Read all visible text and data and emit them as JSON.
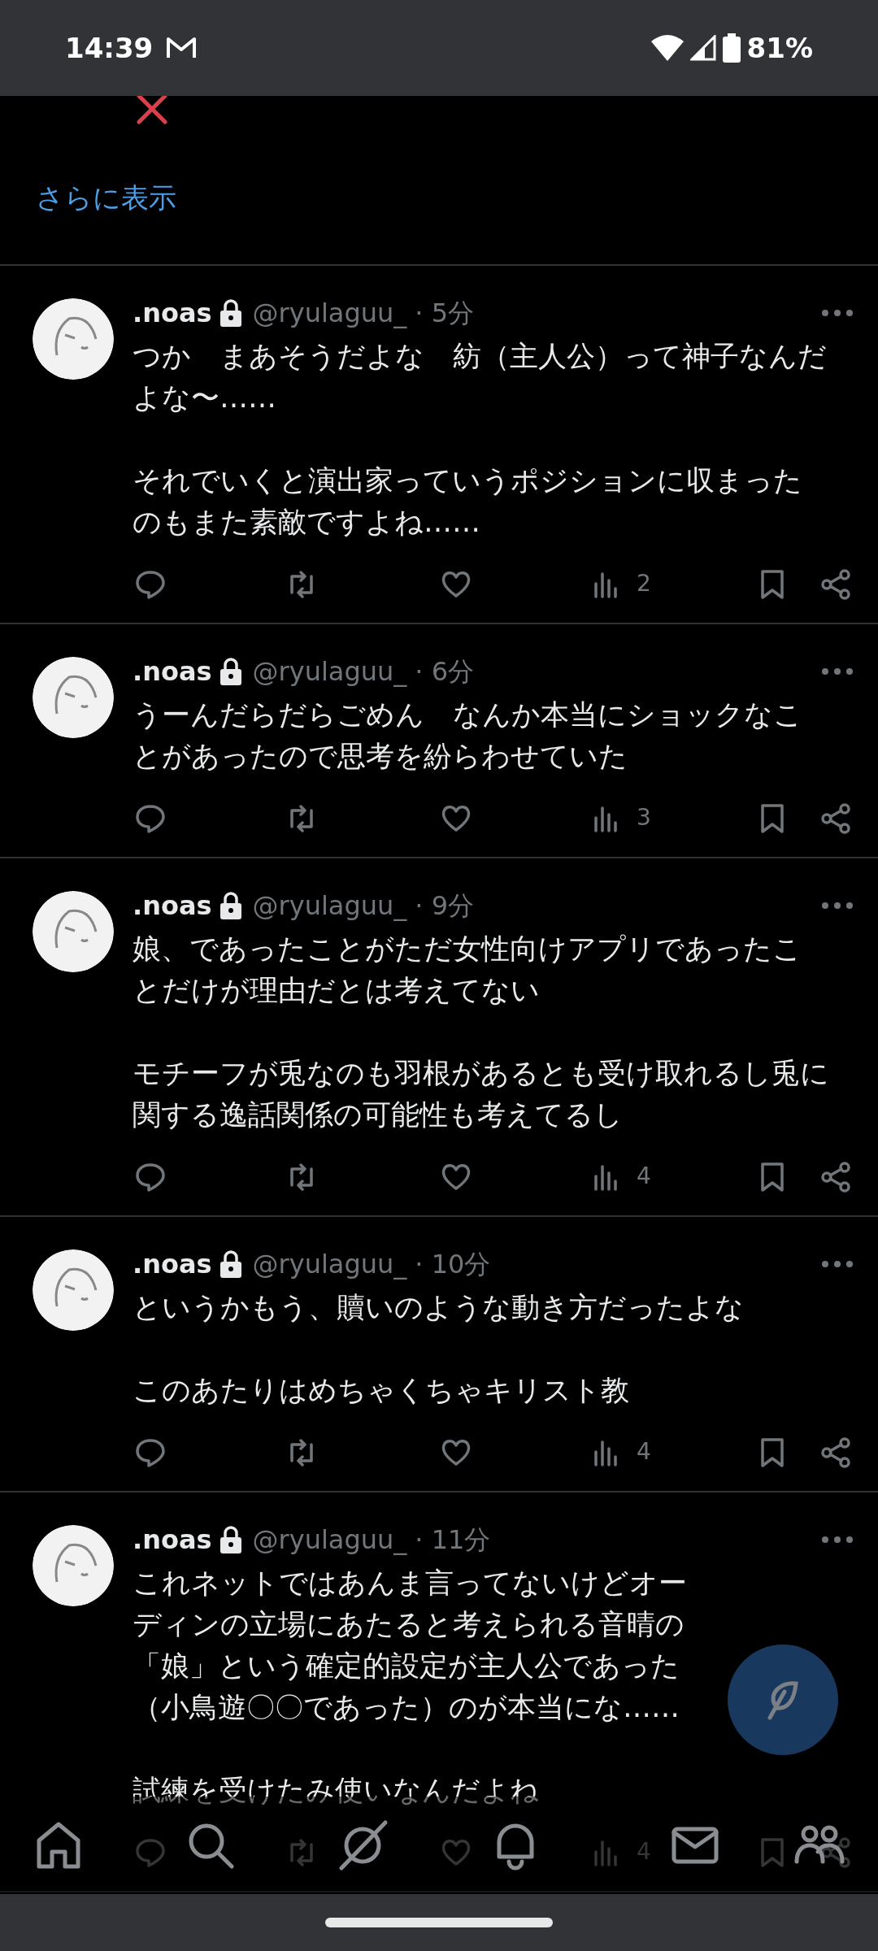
{
  "status_bar": {
    "time": "14:39",
    "battery": "81%"
  },
  "previous_post": {
    "show_more": "さらに表示"
  },
  "posts": [
    {
      "name": ".noas",
      "handle": "@ryulaguu_",
      "time": "· 5分",
      "paragraphs": [
        "つか　まあそうだよな　紡（主人公）って神子なんだよな〜……",
        "それでいくと演出家っていうポジションに収まったのもまた素敵ですよね……"
      ],
      "views": "2"
    },
    {
      "name": ".noas",
      "handle": "@ryulaguu_",
      "time": "· 6分",
      "paragraphs": [
        "うーんだらだらごめん　なんか本当にショックなことがあったので思考を紛らわせていた"
      ],
      "views": "3"
    },
    {
      "name": ".noas",
      "handle": "@ryulaguu_",
      "time": "· 9分",
      "paragraphs": [
        "娘、であったことがただ女性向けアプリであったことだけが理由だとは考えてない",
        "モチーフが兎なのも羽根があるとも受け取れるし兎に関する逸話関係の可能性も考えてるし"
      ],
      "views": "4"
    },
    {
      "name": ".noas",
      "handle": "@ryulaguu_",
      "time": "· 10分",
      "paragraphs": [
        "というかもう、贖いのような動き方だったよな",
        "このあたりはめちゃくちゃキリスト教"
      ],
      "views": "4"
    },
    {
      "name": ".noas",
      "handle": "@ryulaguu_",
      "time": "· 11分",
      "paragraphs": [
        "これネットではあんま言ってないけどオーディンの立場にあたると考えられる音晴の「娘」という確定的設定が主人公であった（小鳥遊〇〇であった）のが本当にな……",
        "試練を受けたみ使いなんだよね"
      ],
      "views": "4"
    }
  ]
}
